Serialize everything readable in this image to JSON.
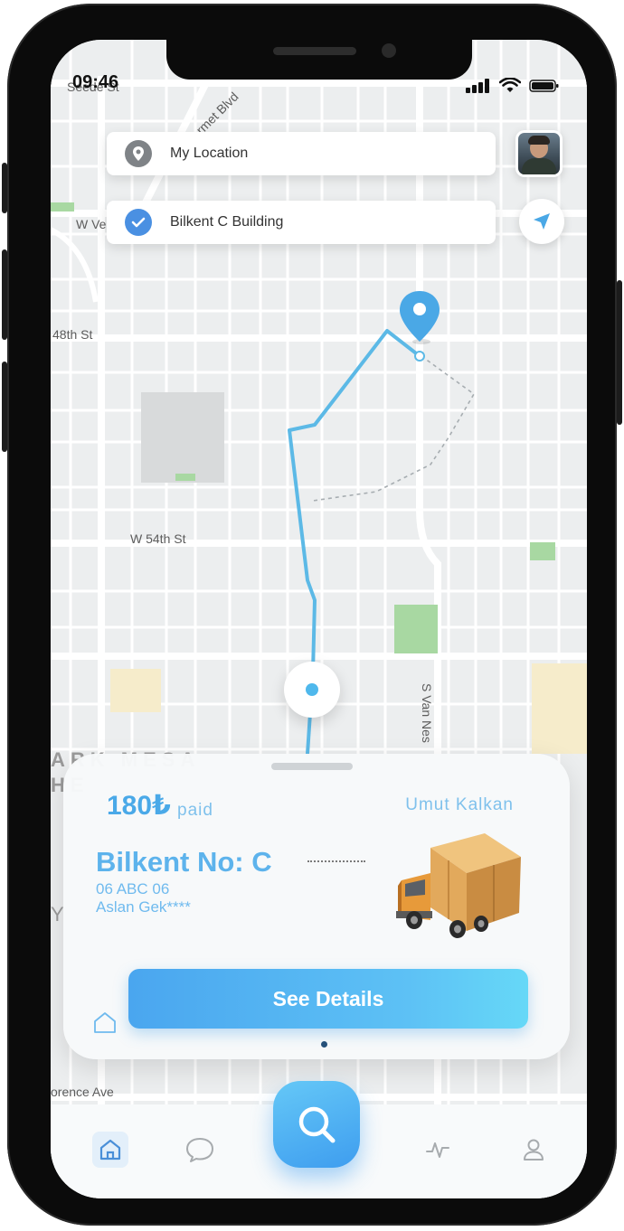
{
  "status_bar": {
    "time": "09:46"
  },
  "map": {
    "street_labels": {
      "top_left": "Seede St",
      "diagonal": "ermet Blvd",
      "w_v": "W Ve",
      "st48": "48th St",
      "w54": "W 54th St",
      "van_ness": "S Van Nes",
      "florence": "orence Ave",
      "area1": "ARK MESA",
      "area2": "HE",
      "area3": "Y"
    }
  },
  "search": {
    "from_label": "My Location",
    "to_label": "Bilkent C Building"
  },
  "delivery": {
    "price": "180₺",
    "price_suffix": "paid",
    "driver_name": "Umut Kalkan",
    "destination": "Bilkent No: C",
    "plate": "06 ABC 06",
    "owner": "Aslan Gek****",
    "button_label": "See Details"
  },
  "nav": {
    "items": [
      "home-icon",
      "chat-icon",
      "search-icon",
      "activity-icon",
      "profile-icon"
    ],
    "active": "home-icon"
  },
  "colors": {
    "accent": "#4aa9e8",
    "route": "#5cb9e6",
    "button_start": "#4aa6ef",
    "button_end": "#66d8f7"
  }
}
